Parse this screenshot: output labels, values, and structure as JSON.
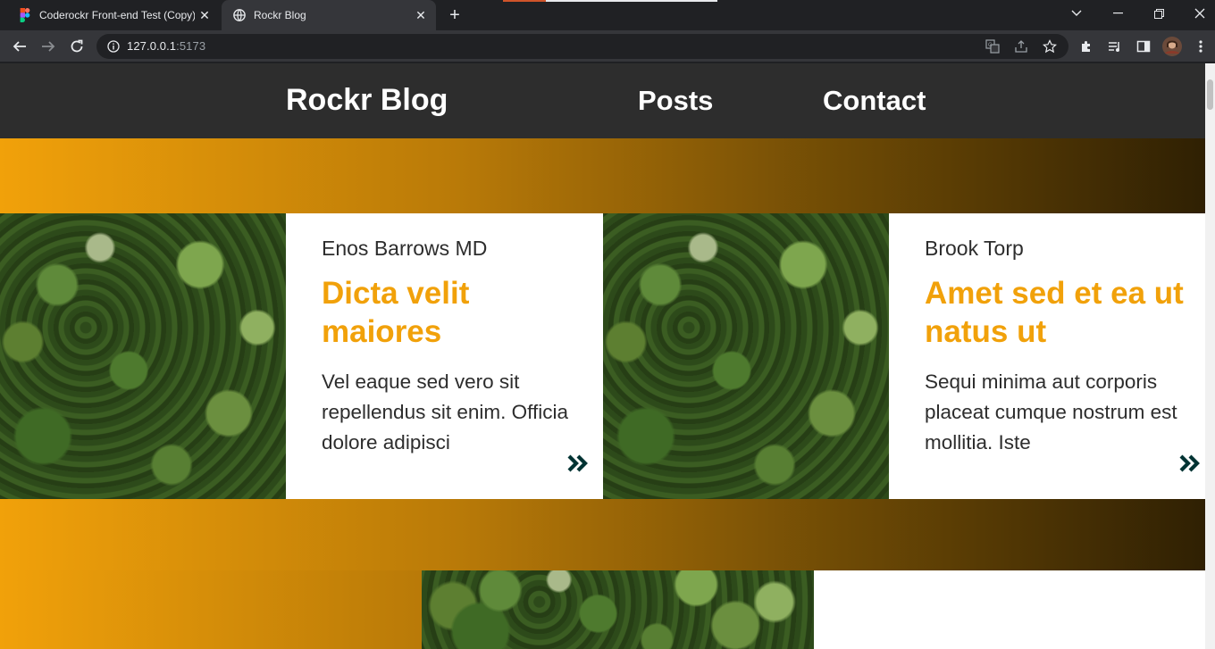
{
  "browser": {
    "tabs": [
      {
        "title": "Coderockr Front-end Test (Copy)",
        "icon": "figma-icon"
      },
      {
        "title": "Rockr Blog",
        "icon": "globe-icon"
      }
    ],
    "url_host": "127.0.0.1",
    "url_port": ":5173"
  },
  "site": {
    "brand": "Rockr Blog",
    "nav": [
      "Posts",
      "Contact"
    ]
  },
  "posts": [
    {
      "author": "Enos Barrows MD",
      "title": "Dicta velit maiores",
      "excerpt": "Vel eaque sed vero sit repellendus sit enim. Officia dolore adipisci"
    },
    {
      "author": "Brook Torp",
      "title": "Amet sed et ea ut natus ut",
      "excerpt": "Sequi minima aut corporis placeat cumque nostrum est mollitia. Iste"
    }
  ],
  "colors": {
    "accent": "#f1a10a",
    "header_bg": "#2d2d2d",
    "text": "#2d2d2d",
    "arrow": "#033"
  }
}
